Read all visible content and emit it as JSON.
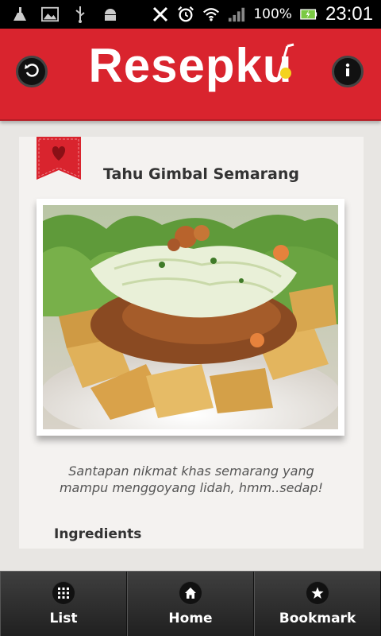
{
  "status_bar": {
    "battery": "100%",
    "time": "23:01"
  },
  "header": {
    "title": "Resepku",
    "colors": {
      "bar": "#d9242e",
      "accent": "#f4d21f"
    },
    "left_icon": "back-icon",
    "right_icon": "info-icon"
  },
  "recipe": {
    "title": "Tahu Gimbal Semarang",
    "description": "Santapan nikmat khas semarang yang mampu menggoyang lidah, hmm..sedap!",
    "section_heading": "Ingredients"
  },
  "bottom_nav": [
    {
      "label": "List",
      "icon": "grid-icon"
    },
    {
      "label": "Home",
      "icon": "home-icon"
    },
    {
      "label": "Bookmark",
      "icon": "star-icon"
    }
  ]
}
